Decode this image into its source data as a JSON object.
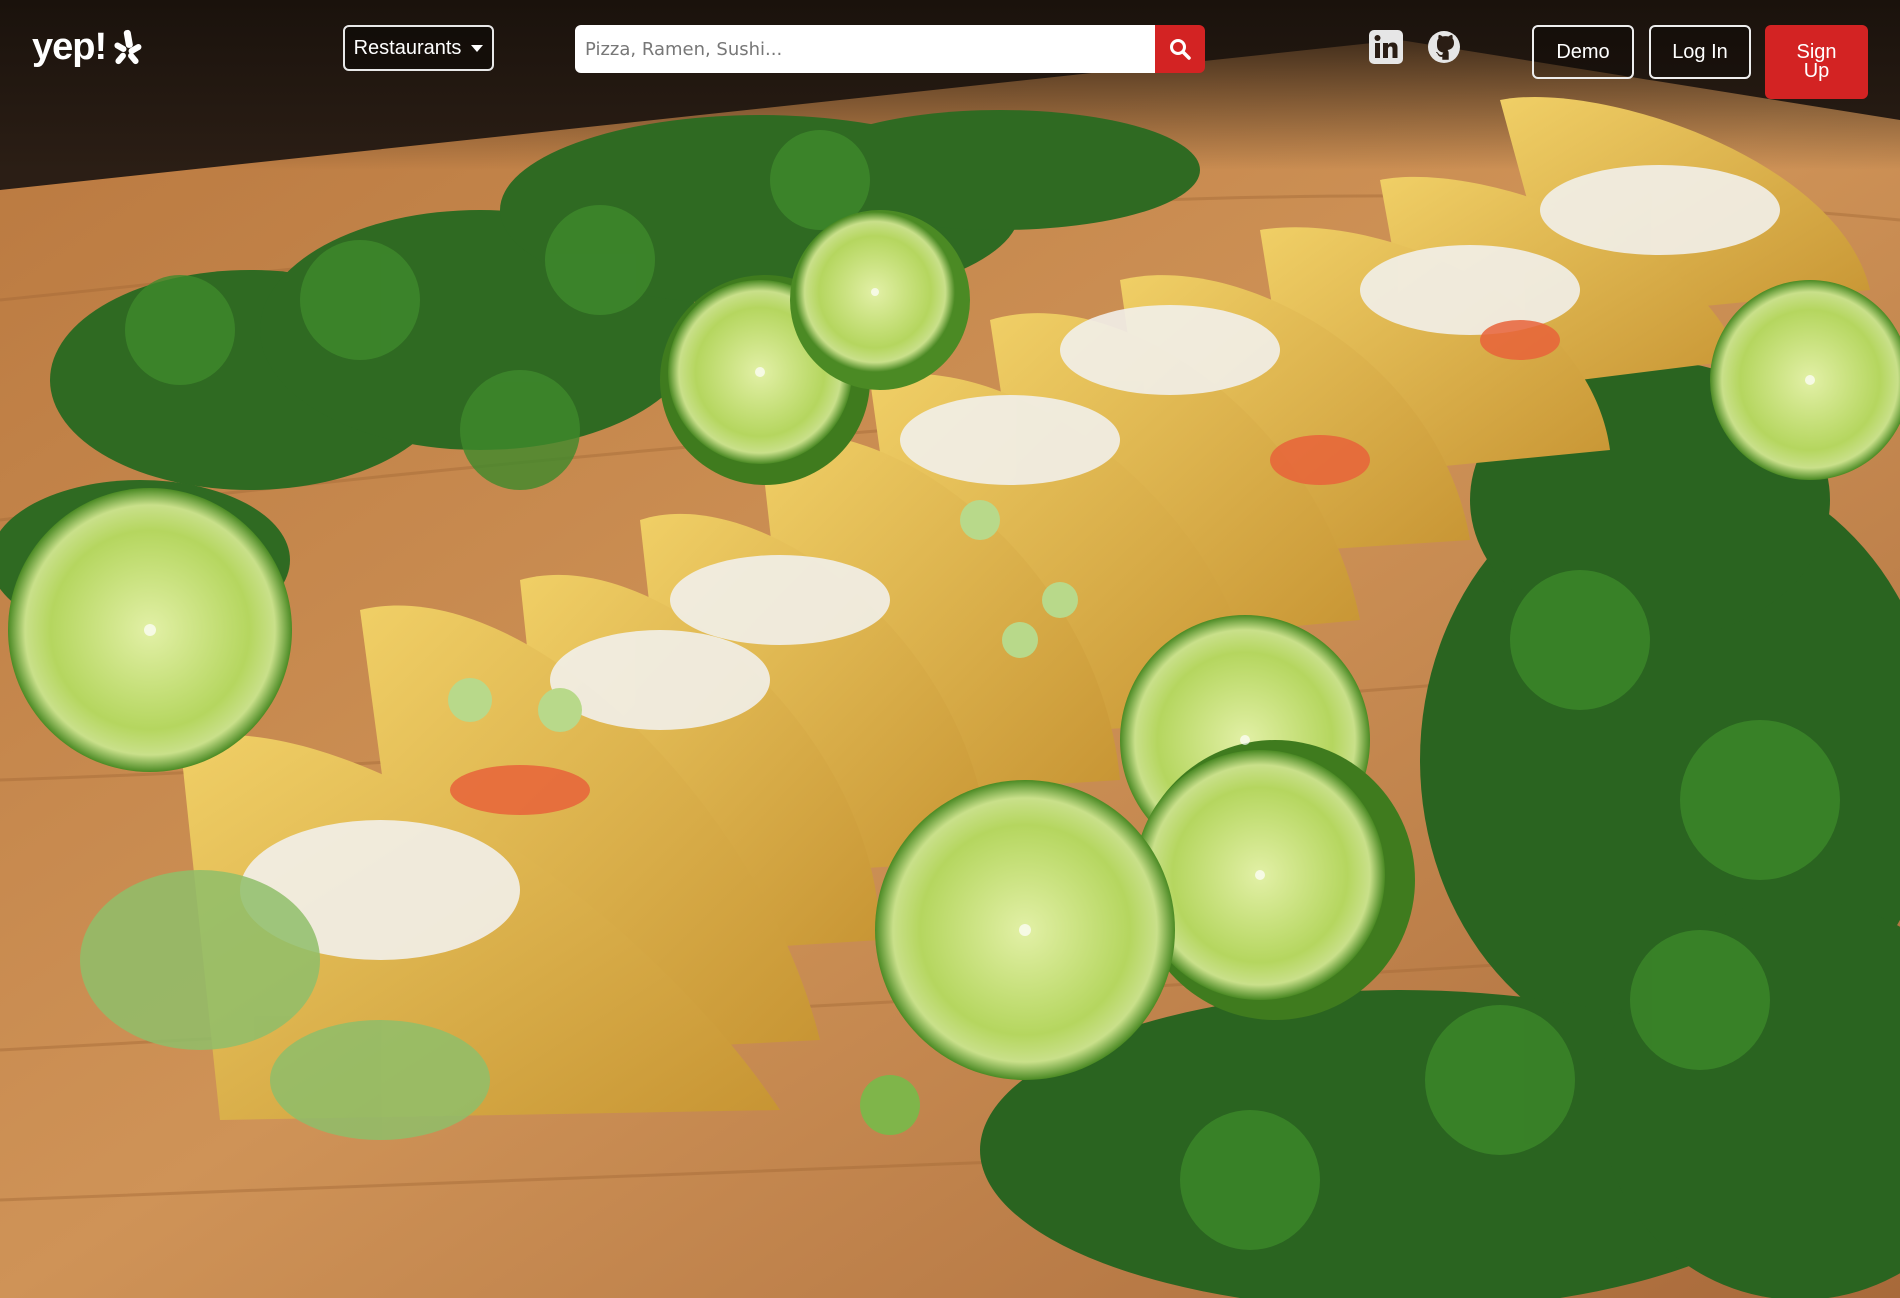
{
  "nav": {
    "logo_text": "yep!",
    "category_dropdown": {
      "selected": "Restaurants"
    },
    "search": {
      "placeholder": "Pizza, Ramen, Sushi..."
    },
    "social_links": [
      "linkedin-icon",
      "github-icon"
    ],
    "demo_label": "Demo",
    "login_label": "Log In",
    "signup_label": "Sign Up"
  },
  "colors": {
    "brand_red": "#d32323",
    "wood": "#c8874c",
    "lime": "#9ccc4a",
    "cilantro": "#2f6a22",
    "tortilla": "#e2b949"
  }
}
